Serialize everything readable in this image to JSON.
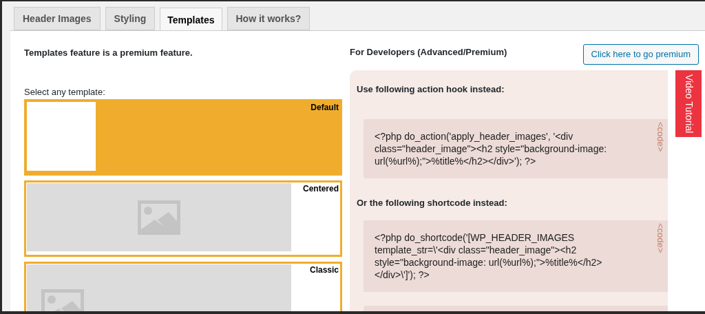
{
  "tabs": [
    {
      "label": "Header Images",
      "selected": false
    },
    {
      "label": "Styling",
      "selected": false
    },
    {
      "label": "Templates",
      "selected": true
    },
    {
      "label": "How it works?",
      "selected": false
    }
  ],
  "left": {
    "notice": "Templates feature is a premium feature.",
    "select_label": "Select any template:",
    "templates": [
      {
        "label": "Default",
        "selected": true,
        "kind": "blank"
      },
      {
        "label": "Centered",
        "selected": false,
        "kind": "centered"
      },
      {
        "label": "Classic",
        "selected": false,
        "kind": "left"
      }
    ]
  },
  "right": {
    "heading": "For Developers (Advanced/Premium)",
    "premium_button": "Click here to go premium",
    "sections": [
      {
        "heading": "Use following action hook instead:",
        "code": "<?php do_action('apply_header_images', '<div class=\"header_image\"><h2 style=\"background-image: url(%url%);\">%title%</h2></div>'); ?>",
        "code_label": "<code>"
      },
      {
        "heading": "Or the following shortcode instead:",
        "code": "<?php do_shortcode('[WP_HEADER_IMAGES template_str=\\'<div class=\"header_image\"><h2 style=\"background-image: url(%url%);\">%title%</h2></div>\\']'); ?>",
        "code_label": "<code>"
      }
    ]
  },
  "video_tab": "Video Tutorial"
}
